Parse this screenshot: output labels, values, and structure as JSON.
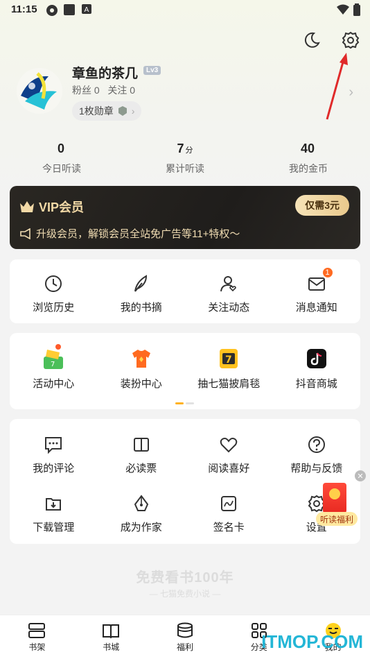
{
  "status_bar": {
    "time": "11:15"
  },
  "profile": {
    "name": "章鱼的茶几",
    "level": "Lv3",
    "fans_label": "粉丝",
    "fans_count": "0",
    "follow_label": "关注",
    "follow_count": "0",
    "badge_text": "1枚勋章"
  },
  "stats": [
    {
      "value": "0",
      "unit": "",
      "label": "今日听读"
    },
    {
      "value": "7",
      "unit": "分",
      "label": "累计听读"
    },
    {
      "value": "40",
      "unit": "",
      "label": "我的金币"
    }
  ],
  "vip": {
    "title": "VIP会员",
    "button": "仅需3元",
    "subtitle": "升级会员，解锁会员全站免广告等11+特权～"
  },
  "quick_actions": [
    {
      "label": "浏览历史",
      "icon": "clock-icon"
    },
    {
      "label": "我的书摘",
      "icon": "feather-icon"
    },
    {
      "label": "关注动态",
      "icon": "user-heart-icon"
    },
    {
      "label": "消息通知",
      "icon": "mail-icon",
      "badge": "1"
    }
  ],
  "activities": [
    {
      "label": "活动中心",
      "icon": "activity-center-icon"
    },
    {
      "label": "装扮中心",
      "icon": "tshirt-icon"
    },
    {
      "label": "抽七猫披肩毯",
      "icon": "lucky-draw-icon"
    },
    {
      "label": "抖音商城",
      "icon": "douyin-icon"
    }
  ],
  "services_row1": [
    {
      "label": "我的评论",
      "icon": "comment-icon"
    },
    {
      "label": "必读票",
      "icon": "ticket-book-icon"
    },
    {
      "label": "阅读喜好",
      "icon": "heart-icon"
    },
    {
      "label": "帮助与反馈",
      "icon": "help-icon"
    }
  ],
  "services_row2": [
    {
      "label": "下载管理",
      "icon": "download-icon"
    },
    {
      "label": "成为作家",
      "icon": "pen-nib-icon"
    },
    {
      "label": "签名卡",
      "icon": "signature-icon"
    },
    {
      "label": "设置",
      "icon": "gear-icon"
    }
  ],
  "floating": {
    "label": "听读福利"
  },
  "footer": {
    "slogan": "免费看书100年",
    "sub": "— 七猫免费小说 —"
  },
  "tabbar": [
    {
      "label": "书架",
      "icon": "bookshelf-icon"
    },
    {
      "label": "书城",
      "icon": "open-book-icon"
    },
    {
      "label": "福利",
      "icon": "gift-box-icon"
    },
    {
      "label": "分类",
      "icon": "grid-icon"
    },
    {
      "label": "我的",
      "icon": "smiley-icon"
    }
  ],
  "watermark": "ITMOP.COM",
  "colors": {
    "accent": "#ff6a21",
    "vip_gold": "#f2d9a6",
    "watermark": "#23b6d6"
  }
}
